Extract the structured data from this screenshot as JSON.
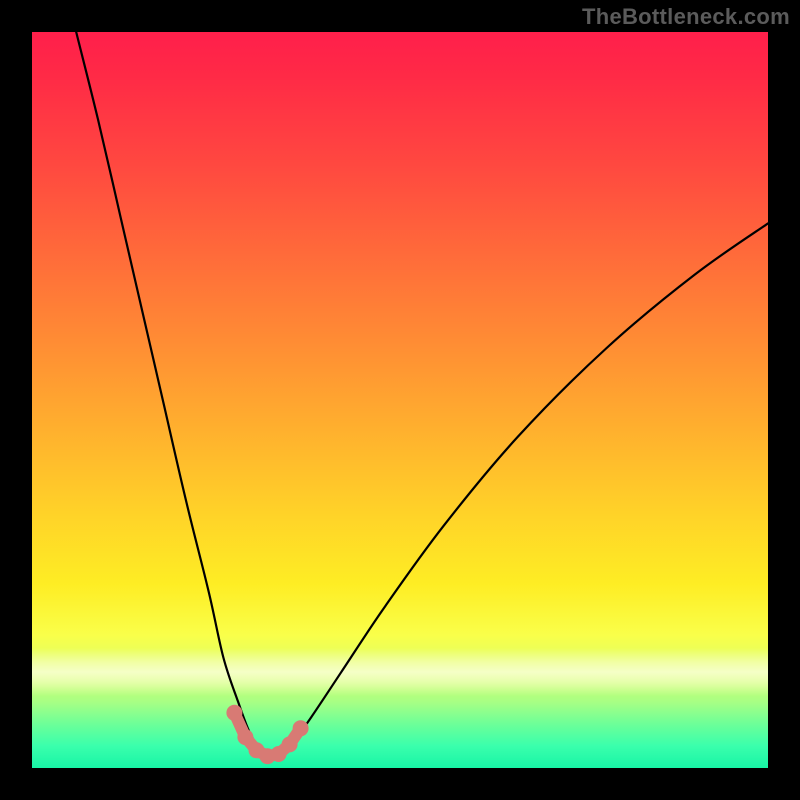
{
  "watermark": "TheBottleneck.com",
  "chart_data": {
    "type": "line",
    "title": "",
    "xlabel": "",
    "ylabel": "",
    "xlim": [
      0,
      100
    ],
    "ylim": [
      0,
      100
    ],
    "background_gradient": {
      "top": "#ff1f4b",
      "mid": "#ffd428",
      "bottom": "#18f5a6"
    },
    "series": [
      {
        "name": "bottleneck-curve",
        "color": "#000000",
        "x": [
          6,
          9,
          12,
          15,
          18,
          21,
          24,
          26,
          28,
          29.5,
          31,
          32.5,
          34,
          35.5,
          38,
          42,
          48,
          56,
          66,
          78,
          90,
          100
        ],
        "y": [
          100,
          88,
          75,
          62,
          49,
          36,
          24,
          15,
          9,
          5,
          2.5,
          1.5,
          2,
          3.5,
          7,
          13,
          22,
          33,
          45,
          57,
          67,
          74
        ]
      }
    ],
    "highlight_region": {
      "note": "pink marker segment near curve minimum",
      "color": "#d87a74",
      "x": [
        27.5,
        29,
        30.5,
        32,
        33.5,
        35,
        36.5
      ],
      "y": [
        7.5,
        4.2,
        2.4,
        1.6,
        1.9,
        3.2,
        5.4
      ]
    },
    "bright_band_y": 12
  }
}
